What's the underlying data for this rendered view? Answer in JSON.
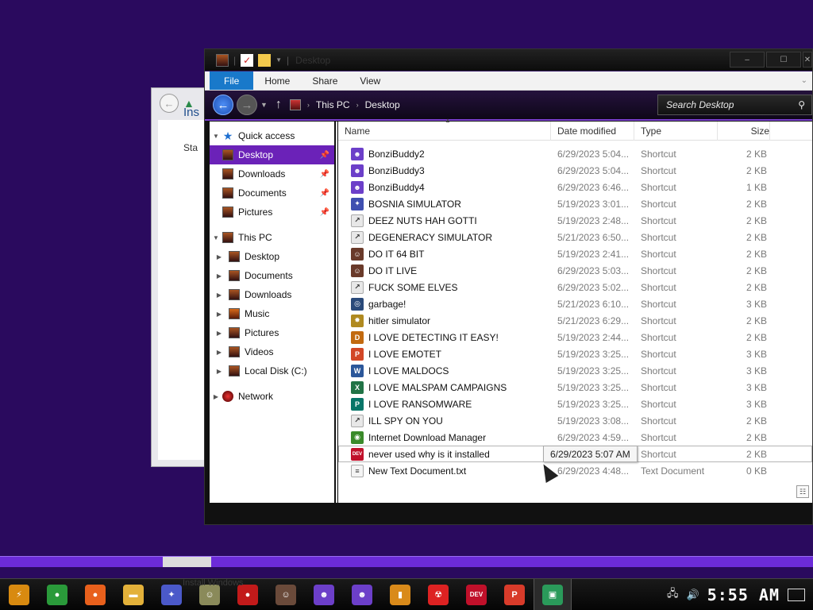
{
  "colors": {
    "desktop_bg": "#2a0a5e",
    "accent": "#6b22b8",
    "file_tab": "#1979ca"
  },
  "background_window": {
    "heading": "Ins",
    "text": "Sta"
  },
  "window": {
    "title": "Desktop",
    "controls": {
      "minimize": "–",
      "maximize": "☐"
    }
  },
  "ribbon": {
    "tabs": [
      "File",
      "Home",
      "Share",
      "View"
    ]
  },
  "address": {
    "crumbs": [
      "This PC",
      "Desktop"
    ],
    "search_placeholder": "Search Desktop"
  },
  "nav": {
    "quick_access": "Quick access",
    "quick_items": [
      {
        "label": "Desktop",
        "pinned": true,
        "selected": true
      },
      {
        "label": "Downloads",
        "pinned": true
      },
      {
        "label": "Documents",
        "pinned": true
      },
      {
        "label": "Pictures",
        "pinned": true
      }
    ],
    "this_pc": "This PC",
    "pc_items": [
      "Desktop",
      "Documents",
      "Downloads",
      "Music",
      "Pictures",
      "Videos",
      "Local Disk (C:)"
    ],
    "network": "Network"
  },
  "columns": {
    "name": "Name",
    "date": "Date modified",
    "type": "Type",
    "size": "Size"
  },
  "files": [
    {
      "name": "BonziBuddy2",
      "date": "6/29/2023 5:04...",
      "type": "Shortcut",
      "size": "2 KB",
      "icon": "bonzi-icon"
    },
    {
      "name": "BonziBuddy3",
      "date": "6/29/2023 5:04...",
      "type": "Shortcut",
      "size": "2 KB",
      "icon": "bonzi-icon"
    },
    {
      "name": "BonziBuddy4",
      "date": "6/29/2023 6:46...",
      "type": "Shortcut",
      "size": "1 KB",
      "icon": "bonzi-icon"
    },
    {
      "name": "BOSNIA SIMULATOR",
      "date": "5/19/2023 3:01...",
      "type": "Shortcut",
      "size": "2 KB",
      "icon": "star-icon"
    },
    {
      "name": "DEEZ NUTS HAH GOTTI",
      "date": "5/19/2023 2:48...",
      "type": "Shortcut",
      "size": "2 KB",
      "icon": "shortcut-icon"
    },
    {
      "name": "DEGENERACY SIMULATOR",
      "date": "5/21/2023 6:50...",
      "type": "Shortcut",
      "size": "2 KB",
      "icon": "shortcut-icon"
    },
    {
      "name": "DO IT 64 BIT",
      "date": "5/19/2023 2:41...",
      "type": "Shortcut",
      "size": "2 KB",
      "icon": "portrait-icon"
    },
    {
      "name": "DO IT LIVE",
      "date": "6/29/2023 5:03...",
      "type": "Shortcut",
      "size": "2 KB",
      "icon": "portrait-icon"
    },
    {
      "name": "FUCK SOME ELVES",
      "date": "6/29/2023 5:02...",
      "type": "Shortcut",
      "size": "2 KB",
      "icon": "shortcut-icon"
    },
    {
      "name": "garbage!",
      "date": "5/21/2023 6:10...",
      "type": "Shortcut",
      "size": "3 KB",
      "icon": "globe-icon"
    },
    {
      "name": "hitler simulator",
      "date": "5/21/2023 6:29...",
      "type": "Shortcut",
      "size": "2 KB",
      "icon": "badge-icon"
    },
    {
      "name": "I LOVE DETECTING IT EASY!",
      "date": "5/19/2023 2:44...",
      "type": "Shortcut",
      "size": "2 KB",
      "icon": "die-icon"
    },
    {
      "name": "I LOVE EMOTET",
      "date": "5/19/2023 3:25...",
      "type": "Shortcut",
      "size": "3 KB",
      "icon": "powerpoint-icon"
    },
    {
      "name": "I LOVE MALDOCS",
      "date": "5/19/2023 3:25...",
      "type": "Shortcut",
      "size": "3 KB",
      "icon": "word-icon"
    },
    {
      "name": "I LOVE MALSPAM CAMPAIGNS",
      "date": "5/19/2023 3:25...",
      "type": "Shortcut",
      "size": "3 KB",
      "icon": "excel-icon"
    },
    {
      "name": "I LOVE RANSOMWARE",
      "date": "5/19/2023 3:25...",
      "type": "Shortcut",
      "size": "3 KB",
      "icon": "publisher-icon"
    },
    {
      "name": "ILL SPY ON YOU",
      "date": "5/19/2023 3:08...",
      "type": "Shortcut",
      "size": "2 KB",
      "icon": "shortcut-icon"
    },
    {
      "name": "Internet Download Manager",
      "date": "6/29/2023 4:59...",
      "type": "Shortcut",
      "size": "2 KB",
      "icon": "idm-icon"
    },
    {
      "name": "never used why is it installed",
      "date": "6/29/2023 5:07...",
      "type": "Shortcut",
      "size": "2 KB",
      "icon": "devcpp-icon",
      "tooltip": "6/29/2023 5:07 AM"
    },
    {
      "name": "New Text Document.txt",
      "date": "6/29/2023 4:48...",
      "type": "Text Document",
      "size": "0 KB",
      "icon": "text-file-icon"
    }
  ],
  "taskbar": {
    "ghost_label": "Install Windows",
    "clock": "5:55 AM",
    "apps": [
      {
        "name": "start-button",
        "glyph": "⚡",
        "color": "#d88a10"
      },
      {
        "name": "chrome-icon",
        "glyph": "●",
        "color": "#2a9a3a"
      },
      {
        "name": "firefox-icon",
        "glyph": "●",
        "color": "#e8601c"
      },
      {
        "name": "file-explorer-icon",
        "glyph": "▬",
        "color": "#e3b13a"
      },
      {
        "name": "star-app-icon",
        "glyph": "✦",
        "color": "#4b59c9"
      },
      {
        "name": "portrait-app-icon",
        "glyph": "☺",
        "color": "#8a8a5a"
      },
      {
        "name": "mask-app-icon",
        "glyph": "●",
        "color": "#c21a1a"
      },
      {
        "name": "woman-app-icon",
        "glyph": "☺",
        "color": "#6a4a3a"
      },
      {
        "name": "bonzi-app-icon",
        "glyph": "☻",
        "color": "#6c3fc9"
      },
      {
        "name": "bonzi-app-icon-2",
        "glyph": "☻",
        "color": "#6c3fc9"
      },
      {
        "name": "scroll-app-icon",
        "glyph": "▮",
        "color": "#d98a1a"
      },
      {
        "name": "radiation-app-icon",
        "glyph": "☢",
        "color": "#d22"
      },
      {
        "name": "devcpp-app-icon",
        "glyph": "DEV",
        "color": "#c0102a"
      },
      {
        "name": "pdf-app-icon",
        "glyph": "P",
        "color": "#d83b2a"
      },
      {
        "name": "installer-app-icon",
        "glyph": "▣",
        "color": "#2a9a5a"
      }
    ]
  }
}
